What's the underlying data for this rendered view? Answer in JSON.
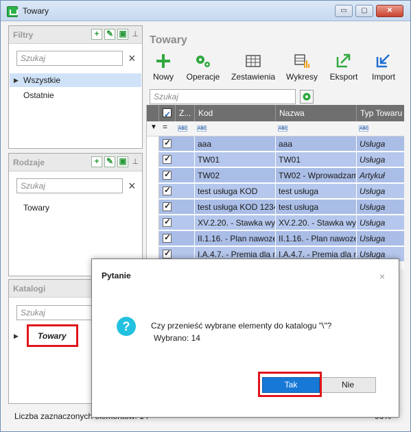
{
  "window": {
    "title": "Towary",
    "minimize": "▭",
    "maximize": "▢",
    "close": "✕"
  },
  "panels": {
    "filtry": {
      "title": "Filtry",
      "search_placeholder": "Szukaj",
      "items": [
        "Wszystkie",
        "Ostatnie"
      ]
    },
    "rodzaje": {
      "title": "Rodzaje",
      "search_placeholder": "Szukaj",
      "items": [
        "Towary"
      ]
    },
    "katalogi": {
      "title": "Katalogi",
      "search_placeholder": "Szukaj",
      "items": [
        "Towary"
      ]
    }
  },
  "main": {
    "title": "Towary",
    "toolbar": [
      "Nowy",
      "Operacje",
      "Zestawienia",
      "Wykresy",
      "Eksport",
      "Import"
    ],
    "search_placeholder": "Szukaj",
    "columns": [
      "Z...",
      "Kod",
      "Nazwa",
      "Typ Towaru"
    ],
    "rows": [
      {
        "kod": "aaa",
        "nazwa": "aaa",
        "typ": "Usługa"
      },
      {
        "kod": "TW01",
        "nazwa": "TW01",
        "typ": "Usługa"
      },
      {
        "kod": "TW02",
        "nazwa": "TW02 - Wprowadzam",
        "typ": "Artykuł"
      },
      {
        "kod": "test usługa KOD",
        "nazwa": "test usługa",
        "typ": "Usługa"
      },
      {
        "kod": "test usługa KOD 1234",
        "nazwa": "test usługa",
        "typ": "Usługa"
      },
      {
        "kod": "XV.2.20. - Stawka wyn",
        "nazwa": "XV.2.20. - Stawka wyn",
        "typ": "Usługa"
      },
      {
        "kod": "II.1.16. - Plan nawozen",
        "nazwa": "II.1.16. - Plan nawozen",
        "typ": "Usługa"
      },
      {
        "kod": "I.A.4.7. - Premia dla m",
        "nazwa": "I.A.4.7. - Premia dla m",
        "typ": "Usługa"
      }
    ]
  },
  "status": {
    "selected_label": "Liczba zaznaczonych elementów: 14",
    "zoom": "96%"
  },
  "dialog": {
    "title": "Pytanie",
    "message": "Czy przenieść wybrane elementy do katalogu \"\\\"?",
    "sub": "Wybrano: 14",
    "ok": "Tak",
    "cancel": "Nie",
    "close": "×",
    "icon": "?"
  }
}
